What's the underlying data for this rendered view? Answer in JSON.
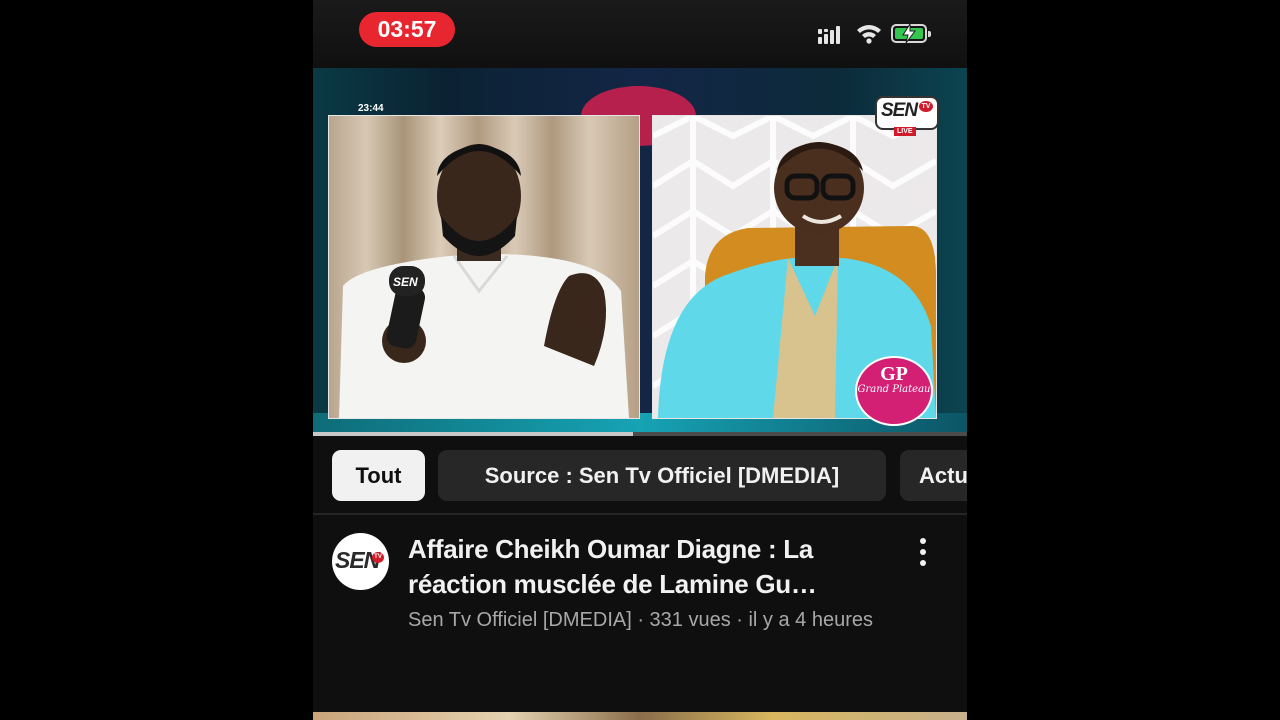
{
  "status_bar": {
    "time": "03:57",
    "icons": [
      "cellular-signal-icon",
      "wifi-icon",
      "battery-charging-icon"
    ],
    "accent_color": "#e8262f",
    "battery_color": "#33c651"
  },
  "player": {
    "overlay_timestamp": "23:44",
    "channel_logo": "SEN",
    "channel_logo_tv": "TV",
    "live_label": "LIVE",
    "show_badge_monogram": "GP",
    "show_badge_name": "Grand Plateau",
    "progress_percent": 49
  },
  "chips": [
    {
      "label": "Tout",
      "selected": true
    },
    {
      "label": "Source : Sen Tv Officiel [DMEDIA]",
      "selected": false
    },
    {
      "label": "Actu",
      "selected": false
    }
  ],
  "video": {
    "channel_avatar_text": "SEN",
    "channel_avatar_tv": "TV",
    "title_line1": "Affaire Cheikh Oumar Diagne : La",
    "title_line2": "réaction musclée de Lamine Gu…",
    "meta": "Sen Tv Officiel [DMEDIA] · 331 vues · il y a 4 heures",
    "menu_icon": "more-vertical-icon"
  }
}
